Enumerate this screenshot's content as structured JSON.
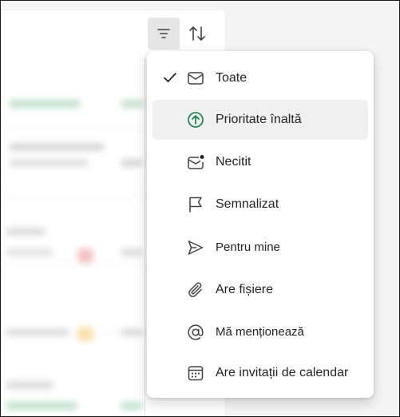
{
  "toolbar": {
    "filter_icon": "filter-lines-icon",
    "sort_icon": "sort-arrows-icon"
  },
  "filter_menu": {
    "selected_index": 0,
    "hovered_index": 1,
    "items": [
      {
        "label": "Toate",
        "icon": "mail-icon",
        "checked": true
      },
      {
        "label": "Prioritate înaltă",
        "icon": "arrow-up-circle-icon",
        "checked": false
      },
      {
        "label": "Necitit",
        "icon": "mail-unread-icon",
        "checked": false
      },
      {
        "label": "Semnalizat",
        "icon": "flag-icon",
        "checked": false
      },
      {
        "label": "Pentru mine",
        "icon": "send-icon",
        "checked": false
      },
      {
        "label": "Are fișiere",
        "icon": "attach-icon",
        "checked": false
      },
      {
        "label": "Mă menționează",
        "icon": "at-icon",
        "checked": false
      },
      {
        "label": "Are invitații de calendar",
        "icon": "calendar-icon",
        "checked": false
      }
    ]
  },
  "colors": {
    "accent_green": "#107c41",
    "text": "#242424",
    "icon": "#424242",
    "hover_bg": "#f0f0f0"
  }
}
